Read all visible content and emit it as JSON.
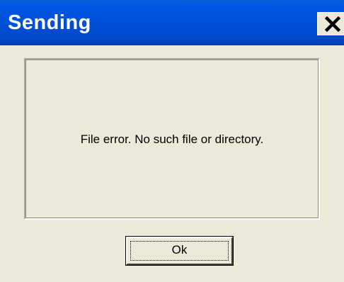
{
  "window": {
    "title": "Sending",
    "title_color": "#ffffff",
    "titlebar_color": "#0050D8",
    "background_color": "#ECE9D8"
  },
  "close_button": {
    "icon": "close-icon"
  },
  "message": {
    "text": "File error. No such file or directory."
  },
  "ok_button": {
    "label": "Ok"
  }
}
